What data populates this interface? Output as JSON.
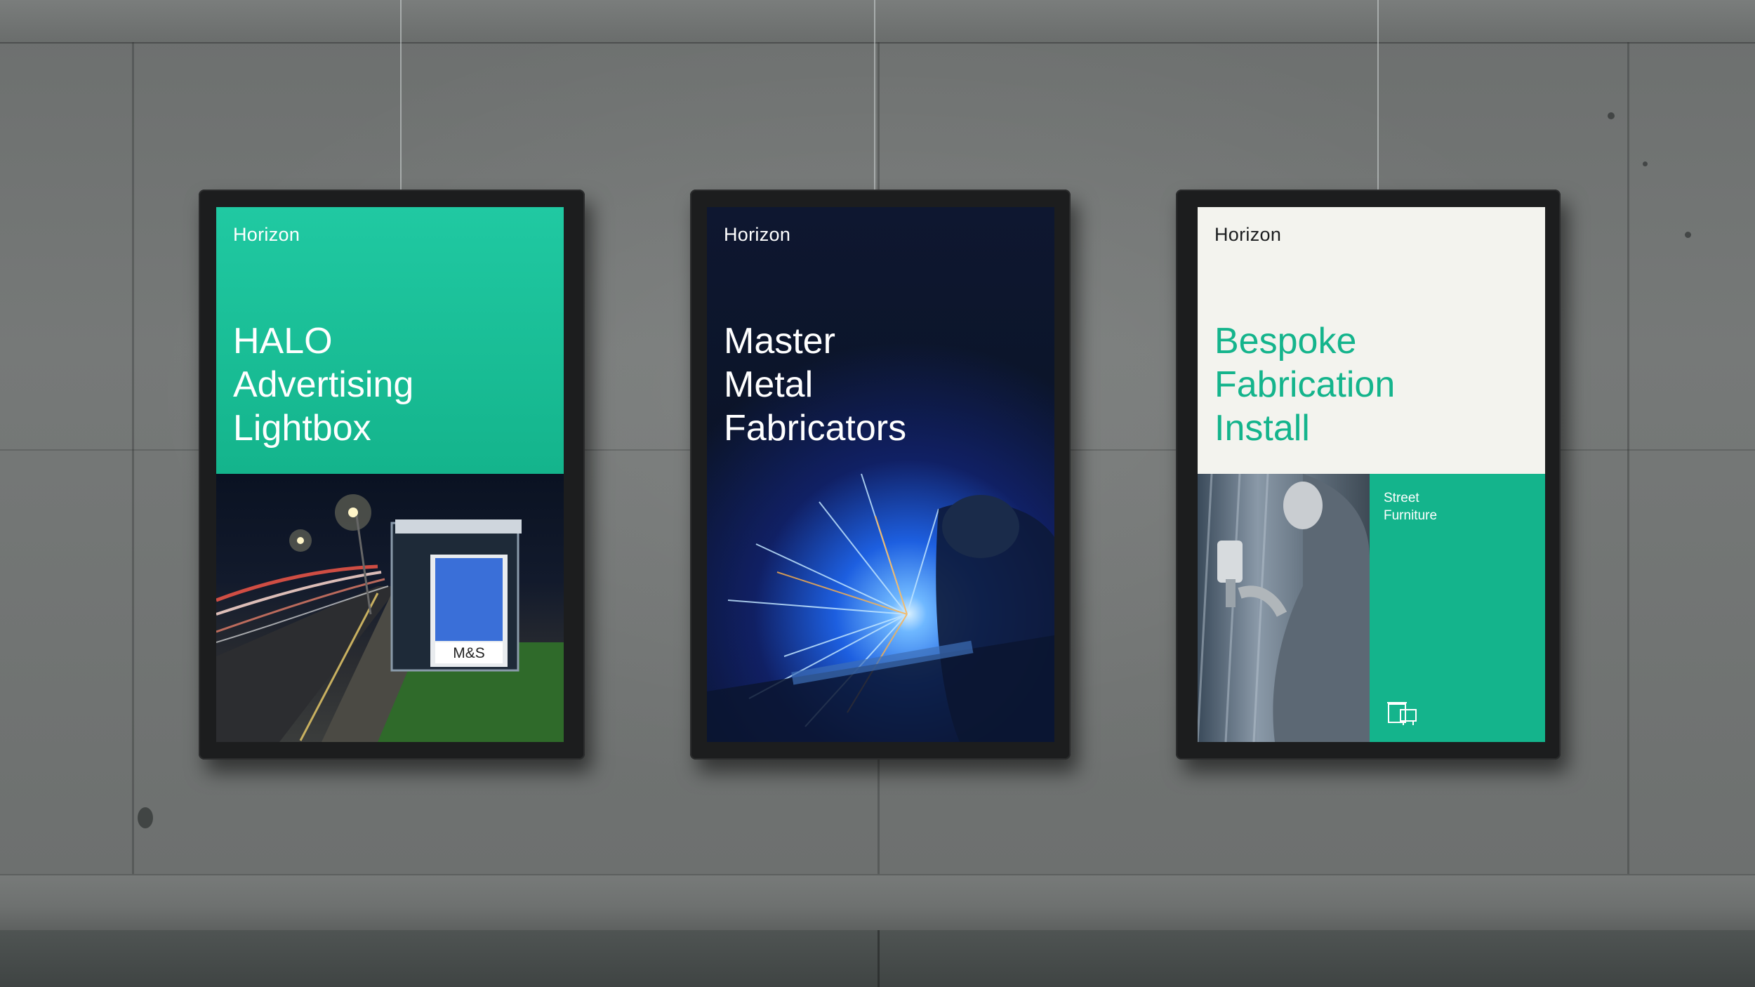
{
  "posters": [
    {
      "brand": "Horizon",
      "headline": "HALO\nAdvertising\nLightbox",
      "bus_shelter_ad": "M&S"
    },
    {
      "brand": "Horizon",
      "headline": "Master\nMetal\nFabricators"
    },
    {
      "brand": "Horizon",
      "headline": "Bespoke\nFabrication\nInstall",
      "tag": "Street\nFurniture",
      "icon": "street-furniture-icon"
    }
  ],
  "colors": {
    "brand_green": "#14b48c",
    "dark_navy": "#0b1428",
    "off_white": "#f3f3ee",
    "frame": "#1c1d1e"
  }
}
